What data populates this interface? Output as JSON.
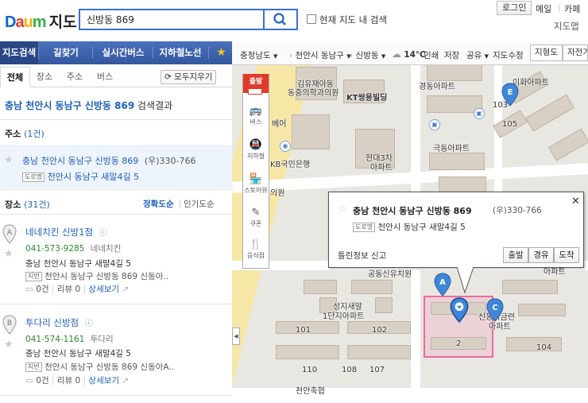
{
  "header": {
    "logo": {
      "d": "D",
      "a": "a",
      "u": "u",
      "m": "m",
      "service": "지도"
    },
    "search_value": "신방동 869",
    "search_icon": "search-icon",
    "checkbox_label": "현재 지도 내 검색",
    "top_links": {
      "login": "로그인",
      "mail": "메일",
      "cafe": "카페",
      "map": "지도맵"
    }
  },
  "nav": {
    "items": [
      "지도검색",
      "길찾기",
      "실시간버스",
      "지하철노선"
    ],
    "star_icon": "star-icon"
  },
  "tabs": {
    "items": [
      "전체",
      "장소",
      "주소",
      "버스"
    ],
    "collapse_all": "모두지우기"
  },
  "result_title": {
    "query": "충남 천안시 동남구 신방동 869",
    "suffix": " 검색결과"
  },
  "address_section": {
    "label": "주소",
    "count": "(1건)",
    "item": {
      "address": "충남 천안시 동남구 신방동 869",
      "postal": "(우)330-766",
      "road_tag": "도로명",
      "road_address": "천안시 동남구 새말4길 5"
    }
  },
  "place_section": {
    "label": "장소",
    "count": "(31건)",
    "sort_accuracy": "정확도순",
    "sort_popular": "인기도순",
    "places": [
      {
        "marker": "A",
        "name": "네네치킨 신방1점",
        "phone": "041-573-9285",
        "brand": "네네치킨",
        "road": "충남 천안시 동남구 새말4길 5",
        "lot_tag": "지번",
        "lot": "천안시 동남구 신방동 869 신동아..",
        "reviews": "0건",
        "review_label": "리뷰 0",
        "detail": "상세보기"
      },
      {
        "marker": "B",
        "name": "투다리 신방점",
        "phone": "041-574-1161",
        "brand": "투다리",
        "road": "충남 천안시 동남구 새말4길 5",
        "lot_tag": "지번",
        "lot": "천안시 동남구 신방동 869 신동아A..",
        "reviews": "0건",
        "review_label": "리뷰 0",
        "detail": "상세보기"
      }
    ]
  },
  "map_toolbar": {
    "province": "충청남도",
    "city": "천안시 동남구",
    "dong": "신방동",
    "weather": "14℃",
    "buttons": [
      "인쇄",
      "저장",
      "공유",
      "지도수정"
    ],
    "map_types": [
      "지형도",
      "자전거"
    ]
  },
  "map_side": {
    "start": "출발",
    "items": [
      "버스",
      "지하철",
      "스토어뷰",
      "쿠폰",
      "음식점"
    ]
  },
  "map_labels": {
    "hospital": "김유재아동",
    "hospital2": "동중의학과의원",
    "kt": "KT쌍용빌딩",
    "kyungdong": "경동아파트",
    "ewha": "이화아파트",
    "hyundai": "현대3차",
    "hyundai2": "아파트",
    "kukdong": "극동아파트",
    "kb": "KB국민은행",
    "beverage": "베어",
    "hos2": "의원",
    "seongji": "성지새말",
    "seongji2": "1단지아파트",
    "shindong": "신동아금련",
    "shindong2": "아파트",
    "community": "공동신유치원",
    "cheonan": "천안축협",
    "num101": "101",
    "num102": "102",
    "num103": "103",
    "num105": "105",
    "num104": "104",
    "num2": "2",
    "num110": "110",
    "num108": "108",
    "num107": "107",
    "apt": "아파트"
  },
  "popup": {
    "title": "충남 천안시 동남구 신방동 869",
    "postal": "(우)330-766",
    "road_tag": "도로명",
    "road": "천안시 동남구 새말4길 5",
    "report": "틀린정보 신고",
    "actions": [
      "출발",
      "경유",
      "도착"
    ]
  },
  "markers": [
    "A",
    "C",
    "E"
  ]
}
